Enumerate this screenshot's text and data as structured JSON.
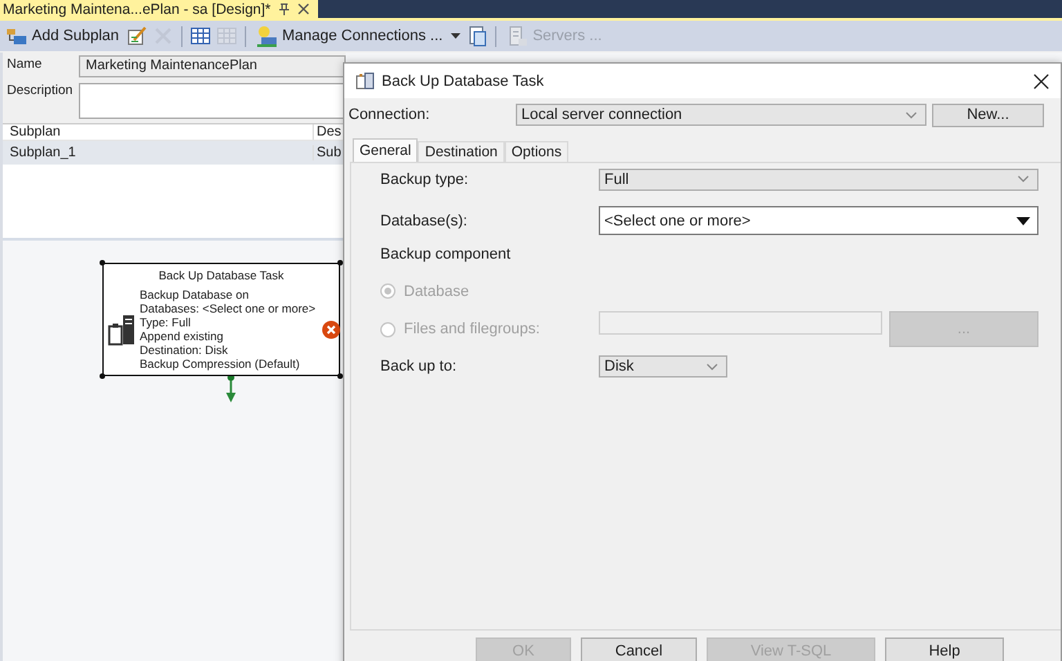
{
  "document_tab": {
    "title": "Marketing Maintena...ePlan - sa [Design]*"
  },
  "toolbar": [
    {
      "kind": "button",
      "label": "Add Subplan",
      "disabled": false
    },
    {
      "kind": "icon",
      "disabled": false
    },
    {
      "kind": "icon",
      "disabled": true
    },
    {
      "kind": "separator"
    },
    {
      "kind": "icon",
      "disabled": false
    },
    {
      "kind": "icon",
      "disabled": true
    },
    {
      "kind": "separator"
    },
    {
      "kind": "button",
      "label": "Manage Connections ...",
      "disabled": false
    },
    {
      "kind": "caret",
      "disabled": false
    },
    {
      "kind": "icon",
      "disabled": false
    },
    {
      "kind": "separator"
    },
    {
      "kind": "button",
      "label": "Servers ...",
      "disabled": true
    }
  ],
  "plan": {
    "name_label": "Name",
    "name": "Marketing MaintenancePlan",
    "description_label": "Description"
  },
  "subplan_grid": {
    "columns": [
      "Subplan",
      "Des"
    ],
    "rows": [
      {
        "cells": [
          "Subplan_1",
          "Sub"
        ],
        "selected": true
      }
    ]
  },
  "task_box": {
    "title": "Back Up Database Task",
    "has_error": true,
    "lines": [
      "Backup Database on",
      "Databases: <Select one or more>",
      "Type: Full",
      "Append existing",
      "Destination: Disk",
      "Backup Compression (Default)"
    ]
  },
  "dialog": {
    "title": "Back Up Database Task",
    "connection": {
      "label": "Connection:",
      "value": "Local server connection"
    },
    "new_button": "New...",
    "tabs": [
      {
        "label": "General",
        "selected": true
      },
      {
        "label": "Destination",
        "selected": false
      },
      {
        "label": "Options",
        "selected": false
      }
    ],
    "fields": [
      {
        "kind": "combo",
        "label": "Backup type:",
        "value": "Full"
      },
      {
        "kind": "multiselect",
        "label": "Database(s):",
        "value": "<Select one or more>"
      },
      {
        "kind": "heading",
        "label": "Backup component"
      },
      {
        "kind": "radio",
        "label": "Database",
        "selected": true,
        "disabled": true
      },
      {
        "kind": "radio-field",
        "label": "Files and filegroups:",
        "selected": false,
        "disabled": true,
        "button": "..."
      },
      {
        "kind": "combo-small",
        "label": "Back up to:",
        "value": "Disk"
      }
    ],
    "buttons": [
      {
        "label": "OK",
        "disabled": true
      },
      {
        "label": "Cancel",
        "disabled": false
      },
      {
        "label": "View T-SQL",
        "disabled": true
      },
      {
        "label": "Help",
        "disabled": false
      }
    ]
  }
}
